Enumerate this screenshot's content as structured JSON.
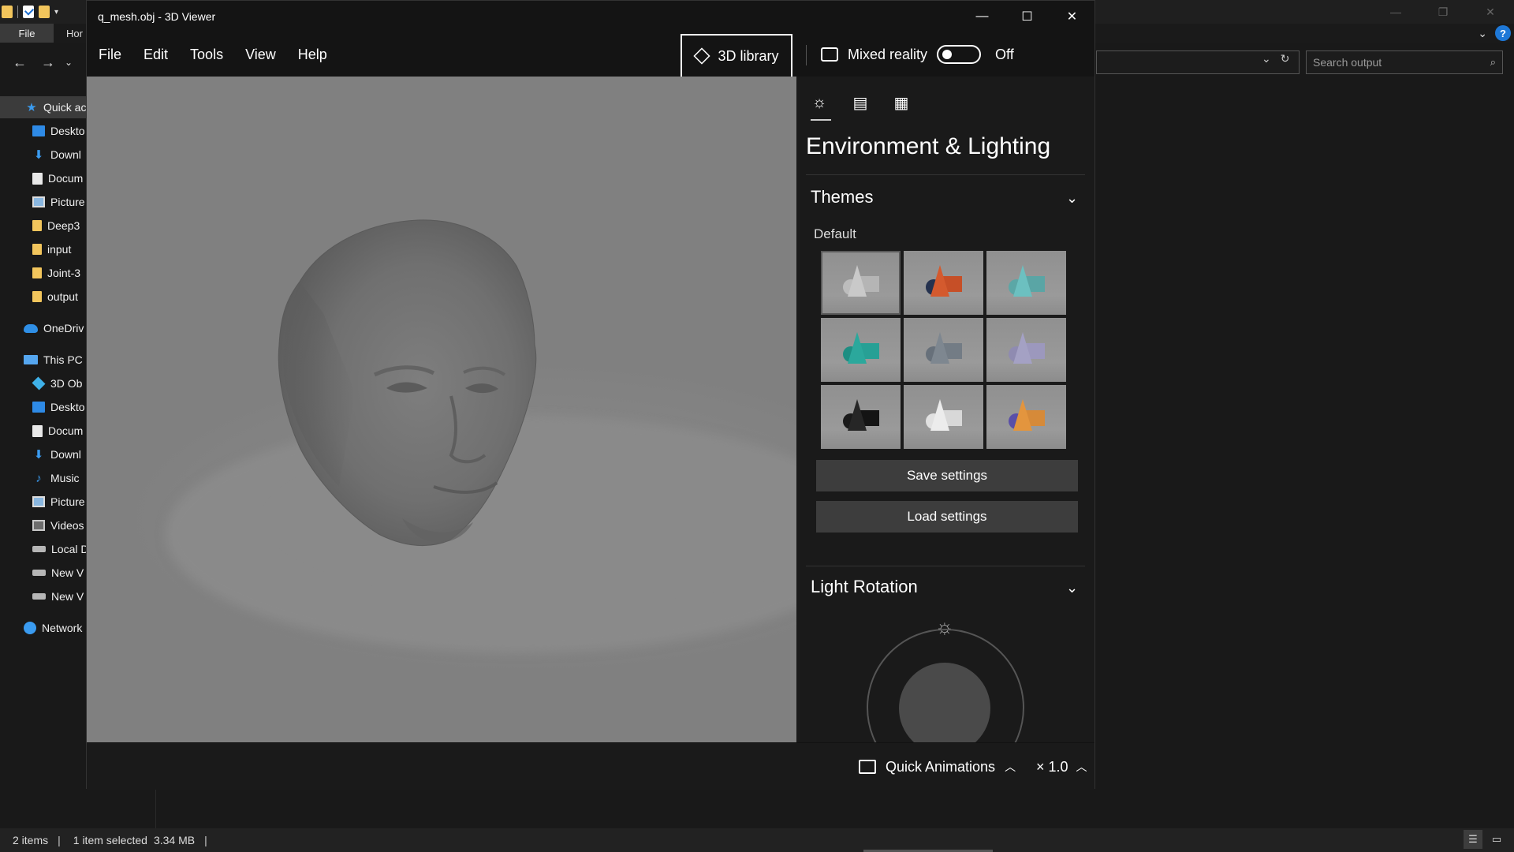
{
  "explorer": {
    "file_tab": "File",
    "home_tab": "Hor",
    "search_placeholder": "Search output",
    "sidebar": [
      {
        "label": "Quick ac",
        "icon": "star-icon"
      },
      {
        "label": "Deskto",
        "icon": "desktop-icon"
      },
      {
        "label": "Downl",
        "icon": "download-icon"
      },
      {
        "label": "Docum",
        "icon": "document-icon"
      },
      {
        "label": "Picture",
        "icon": "pictures-icon"
      },
      {
        "label": "Deep3",
        "icon": "folder-icon"
      },
      {
        "label": "input",
        "icon": "folder-icon"
      },
      {
        "label": "Joint-3",
        "icon": "folder-icon"
      },
      {
        "label": "output",
        "icon": "folder-icon"
      },
      {
        "label": "OneDriv",
        "icon": "onedrive-icon"
      },
      {
        "label": "This PC",
        "icon": "this-pc-icon"
      },
      {
        "label": "3D Ob",
        "icon": "3d-objects-icon"
      },
      {
        "label": "Deskto",
        "icon": "desktop-icon"
      },
      {
        "label": "Docum",
        "icon": "document-icon"
      },
      {
        "label": "Downl",
        "icon": "download-icon"
      },
      {
        "label": "Music",
        "icon": "music-icon"
      },
      {
        "label": "Picture",
        "icon": "pictures-icon"
      },
      {
        "label": "Videos",
        "icon": "videos-icon"
      },
      {
        "label": "Local D",
        "icon": "drive-icon"
      },
      {
        "label": "New V",
        "icon": "drive-icon"
      },
      {
        "label": "New V",
        "icon": "drive-icon"
      },
      {
        "label": "Network",
        "icon": "network-icon"
      }
    ],
    "status": {
      "item_count": "2 items",
      "selection": "1 item selected",
      "size": "3.34 MB"
    }
  },
  "viewer": {
    "title": "q_mesh.obj - 3D Viewer",
    "menu": [
      "File",
      "Edit",
      "Tools",
      "View",
      "Help"
    ],
    "library_button": "3D library",
    "mixed_reality": {
      "label": "Mixed reality",
      "state": "Off"
    },
    "panel": {
      "heading": "Environment & Lighting",
      "themes": {
        "title": "Themes",
        "subtitle": "Default",
        "thumbnails": [
          {
            "name": "default",
            "colors": [
              "#bdbdbd",
              "#c9c9c9",
              "#b5b5b5"
            ]
          },
          {
            "name": "orange-navy",
            "colors": [
              "#25324f",
              "#d45a2e",
              "#c64f27"
            ]
          },
          {
            "name": "teal",
            "colors": [
              "#5ba7a6",
              "#6cc0c0",
              "#5aa5a5"
            ]
          },
          {
            "name": "emerald",
            "colors": [
              "#1d8e82",
              "#2ba89c",
              "#27a095"
            ]
          },
          {
            "name": "slate",
            "colors": [
              "#67707a",
              "#7e8790",
              "#737c85"
            ]
          },
          {
            "name": "lavender",
            "colors": [
              "#8f8bb1",
              "#a4a1c4",
              "#9c98bd"
            ]
          },
          {
            "name": "black",
            "colors": [
              "#1a1a1a",
              "#262626",
              "#141414"
            ]
          },
          {
            "name": "white",
            "colors": [
              "#e1e1e1",
              "#ececec",
              "#d8d8d8"
            ]
          },
          {
            "name": "sunset",
            "colors": [
              "#5a4fa8",
              "#e3953e",
              "#d68a39"
            ]
          }
        ]
      },
      "save_settings": "Save settings",
      "load_settings": "Load settings",
      "light_rotation": "Light Rotation"
    },
    "bottom": {
      "quick_animations": "Quick Animations",
      "speed": "× 1.0"
    }
  }
}
